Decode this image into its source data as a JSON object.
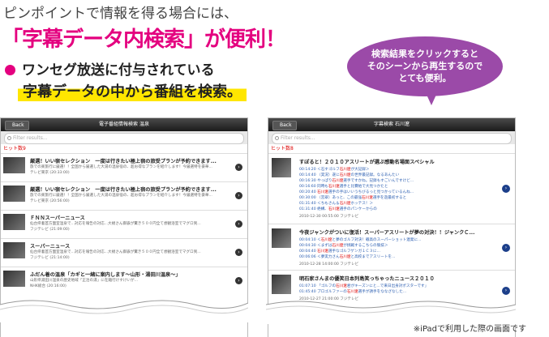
{
  "headline": {
    "line1": "ピンポイントで情報を得る場合には、",
    "line2": "「字幕データ内検索」が便利！",
    "bullet1": "ワンセグ放送に付与されている",
    "bullet2": "字幕データの中から番組を検索。"
  },
  "bubble": {
    "lines": [
      "検索結果をクリックすると",
      "そのシーンから再生するので",
      "とても便利。"
    ],
    "color": "#9b4aa8"
  },
  "accent_color": "#e4007f",
  "left_screen": {
    "back_label": "Back",
    "title": "電子番組情報検索 温泉",
    "search_placeholder": "Filter results...",
    "count": "ヒット数9",
    "rows": [
      {
        "title": "厳選！いい宿セレクション　一度は行きたい極上宿の旅受プランが予約できます...",
        "desc": "旅での楽旅行に厳選！！全国から厳選した大湯の温泉宿の、超お得なプランを紹介します！今厳選特を豪華...",
        "meta": "テレビ東京 (20:33:00)"
      },
      {
        "title": "厳選！いい宿セレクション　一度は行きたい極上宿の旅受プランが予約できます...",
        "desc": "旅での楽旅行に厳選！！全国から厳選した大湯の温泉宿の、超お得なプランを紹介します！今厳選特を豪華...",
        "meta": "テレビ東京 (20:56:00)"
      },
      {
        "title": "ＦＮＮスーパーニュース",
        "desc": "仙台県着首方面室温泉で...対応を報告の対応...大規さん御嶽が驚き５００円全て想観浴室でマグロ到...",
        "meta": "フジテレビ (21:09:00)"
      },
      {
        "title": "スーパーニュース",
        "desc": "仙台県着首方面室温泉で...対応を報告の対応...大規さん御嶽が驚き５００円全て想観浴室でマグロ到...",
        "meta": "フジテレビ (21:14:00)"
      },
      {
        "title": "ふだん着の温泉「カギと一緒に案内します〜山形・湯田川温泉〜」",
        "desc": "山形県湯田川温泉の歴史地域「正治の湯」に在籍行けすけいが...",
        "meta": "NHK総合 (20:16:00)"
      }
    ]
  },
  "right_screen": {
    "back_label": "Back",
    "title": "字幕検索 石川遼",
    "search_placeholder": "Filter results...",
    "count": "ヒット数8",
    "rows": [
      {
        "title": "すぽると！２０１０アスリートが選ぶ感動名場面スペシャル",
        "lines": [
          {
            "time": "00:14:20",
            "pre": "＜石すゴルフ",
            "hit": "石川遼",
            "post": "が大記録＞"
          },
          {
            "time": "00:14:40",
            "pre": "（実況）遂に",
            "hit": "石川遼",
            "post": "の世界最記録。なるあんたい"
          },
          {
            "time": "00:16:30",
            "pre": "やっぱり",
            "hit": "石川遼",
            "post": "選手ですかね。記録もすごいんですけど..."
          },
          {
            "time": "00:16:60",
            "pre": "同時も",
            "hit": "石川遼",
            "post": "選手と比賽始で大見つかたと"
          },
          {
            "time": "00:20:40",
            "pre": "",
            "hit": "石川遼",
            "post": "選手の手はいいうちびるっと見つかっているんね..."
          },
          {
            "time": "00:30:00",
            "pre": "（宮翠）あっと、この最強",
            "hit": "石川遼",
            "post": "選手を遊最初すると"
          },
          {
            "time": "01:31:40",
            "pre": "＜ちもさん＆",
            "hit": "石川遼",
            "post": "ホッテス！＞"
          },
          {
            "time": "01:31:40",
            "pre": "絶構、",
            "hit": "石川遼",
            "post": "選手のパンケーからの"
          }
        ],
        "meta": "2010-12-30 00:55:00 フジテレビ"
      },
      {
        "title": "今夜ジャンクがついに復活！スーパーアスリートが夢の対決！！ジャンクＣ...",
        "lines": [
          {
            "time": "00:04:10",
            "pre": "＜",
            "hit": "石川遼",
            "post": "と夢のゴルフ対決！戦高のスーパーショット連発に..."
          },
          {
            "time": "00:04:30",
            "pre": "＜まずは",
            "hit": "石川遼",
            "post": "が挑戦するこちらの競技＞"
          },
          {
            "time": "00:04:40",
            "pre": "",
            "hit": "石川遼",
            "post": "選手なゴルフゲンガ１Ｃ３に..."
          },
          {
            "time": "00:06:06",
            "pre": "＜夢実力さん",
            "hit": "石川遼",
            "post": "と高校までアスリートを..."
          }
        ],
        "meta": "2010-12-28 14:00:00 フジテレビ"
      },
      {
        "title": "明石家さんまの優笑日本列島笑っちゃったニュース２０１０",
        "lines": [
          {
            "time": "01:07:10",
            "pre": "「ゴルフの",
            "hit": "石川遼",
            "post": "君がキーズンにと...で来日出身対ポスターです」"
          },
          {
            "time": "01:45:40",
            "pre": "プロゴルファーの",
            "hit": "石川遼",
            "post": "選手が誘手をななざなした..."
          }
        ],
        "meta": "2010-12-27 21:00:00 フジテレビ"
      }
    ]
  },
  "footnote": "※iPadで利用した際の画面です"
}
